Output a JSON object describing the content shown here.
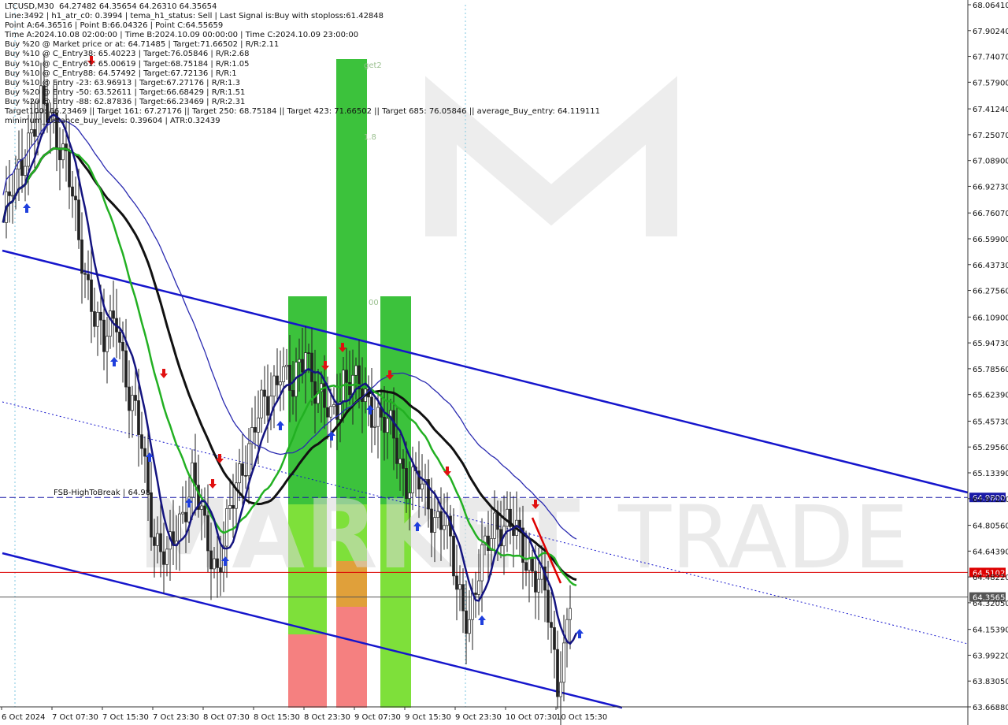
{
  "info_lines": [
    "LTCUSD,M30  64.27482 64.35654 64.26310 64.35654",
    "Line:3492 | h1_atr_c0: 0.3994 | tema_h1_status: Sell | Last Signal is:Buy with stoploss:61.42848",
    "Point A:64.36516 | Point B:66.04326 | Point C:64.55659",
    "Time A:2024.10.08 02:00:00 | Time B:2024.10.09 00:00:00 | Time C:2024.10.09 23:00:00",
    "Buy %20 @ Market price or at: 64.71485 | Target:71.66502 | R/R:2.11",
    "Buy %10 @ C_Entry38: 65.40223 | Target:76.05846 | R/R:2.68",
    "Buy %10 @ C_Entry61: 65.00619 | Target:68.75184 | R/R:1.05",
    "Buy %10 @ C_Entry88: 64.57492 | Target:67.72136 | R/R:1",
    "Buy %10 @ Entry -23: 63.96913 | Target:67.27176 | R/R:1.3",
    "Buy %20 @ Entry -50: 63.52611 | Target:66.68429 | R/R:1.51",
    "Buy %20 @ Entry -88: 62.87836 | Target:66.23469 | R/R:2.31",
    "Target100: 66.23469 || Target 161: 67.27176 || Target 250: 68.75184 || Target 423: 71.66502 || Target 685: 76.05846 || average_Buy_entry: 64.119111",
    "minimum_distance_buy_levels: 0.39604 | ATR:0.32439"
  ],
  "chart_data": {
    "type": "candlestick",
    "symbol": "LTCUSD",
    "timeframe": "M30",
    "ylim": [
      63.6688,
      68.0641
    ],
    "y_ticks": [
      68.0641,
      67.9024,
      67.7407,
      67.579,
      67.4124,
      67.2507,
      67.089,
      66.9273,
      66.7607,
      66.599,
      66.4373,
      66.2756,
      66.109,
      65.9473,
      65.7856,
      65.6239,
      65.4573,
      65.2956,
      65.1339,
      64.9722,
      64.8056,
      64.6439,
      64.4822,
      64.3205,
      64.1539,
      63.9922,
      63.8305,
      63.6688
    ],
    "x_ticks": [
      "6 Oct 2024",
      "7 Oct 07:30",
      "7 Oct 15:30",
      "7 Oct 23:30",
      "8 Oct 07:30",
      "8 Oct 15:30",
      "8 Oct 23:30",
      "9 Oct 07:30",
      "9 Oct 15:30",
      "9 Oct 23:30",
      "10 Oct 07:30",
      "10 Oct 15:30"
    ],
    "price_levels": [
      {
        "label": "FSB-HighToBreak | 64.98",
        "value": 64.98,
        "price_tag": "64.98000",
        "color": "#1a1aa8"
      },
      {
        "value": 64.51023,
        "price_tag": "64.51023",
        "color": "#dd0000"
      },
      {
        "value": 64.35654,
        "price_tag": "64.35654",
        "color": "#555555"
      }
    ],
    "zone_labels": [
      "get2",
      "1.8",
      "00"
    ],
    "watermark": [
      "M",
      "MARKET",
      "TRADE"
    ],
    "close_path": [
      [
        0,
        66.7
      ],
      [
        4,
        66.95
      ],
      [
        8,
        67.25
      ],
      [
        12,
        67.4
      ],
      [
        16,
        67.35
      ],
      [
        20,
        67.1
      ],
      [
        24,
        66.55
      ],
      [
        28,
        66.25
      ],
      [
        32,
        65.9
      ],
      [
        36,
        66.15
      ],
      [
        40,
        65.6
      ],
      [
        44,
        65.3
      ],
      [
        48,
        64.75
      ],
      [
        52,
        64.55
      ],
      [
        56,
        64.85
      ],
      [
        60,
        65.1
      ],
      [
        64,
        64.75
      ],
      [
        68,
        64.55
      ],
      [
        72,
        64.85
      ],
      [
        76,
        65.2
      ],
      [
        80,
        65.45
      ],
      [
        84,
        65.55
      ],
      [
        88,
        65.85
      ],
      [
        92,
        65.6
      ],
      [
        96,
        65.95
      ],
      [
        100,
        65.6
      ],
      [
        104,
        65.45
      ],
      [
        108,
        65.75
      ],
      [
        112,
        65.65
      ],
      [
        116,
        65.6
      ],
      [
        120,
        65.45
      ],
      [
        124,
        65.35
      ],
      [
        128,
        65.1
      ],
      [
        132,
        65.05
      ],
      [
        136,
        64.9
      ],
      [
        140,
        64.85
      ],
      [
        144,
        64.4
      ],
      [
        148,
        64.25
      ],
      [
        152,
        64.55
      ],
      [
        156,
        64.85
      ],
      [
        160,
        64.8
      ],
      [
        164,
        64.7
      ],
      [
        168,
        64.55
      ],
      [
        172,
        64.35
      ],
      [
        176,
        63.85
      ],
      [
        178,
        64.05
      ],
      [
        180,
        64.35
      ]
    ]
  }
}
